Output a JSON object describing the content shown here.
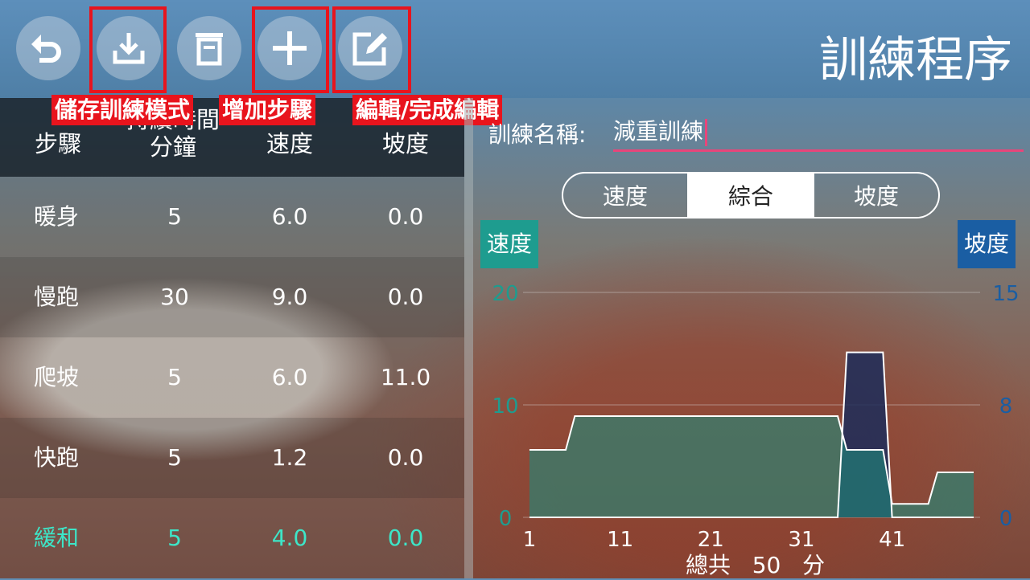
{
  "header": {
    "title": "訓練程序",
    "buttons": [
      {
        "name": "back-button",
        "icon": "back-arrow-icon"
      },
      {
        "name": "save-mode-button",
        "icon": "download-icon"
      },
      {
        "name": "delete-button",
        "icon": "trash-icon"
      },
      {
        "name": "add-step-button",
        "icon": "plus-icon"
      },
      {
        "name": "edit-button",
        "icon": "edit-icon"
      }
    ],
    "callouts": {
      "save": "儲存訓練模式",
      "add": "增加步驟",
      "edit": "編輯/完成編輯"
    }
  },
  "table": {
    "headers": {
      "step": "步驟",
      "duration_line1": "持續時間",
      "duration_line2": "分鐘",
      "speed": "速度",
      "incline": "坡度"
    },
    "rows": [
      {
        "step": "暖身",
        "duration": "5",
        "speed": "6.0",
        "incline": "0.0"
      },
      {
        "step": "慢跑",
        "duration": "30",
        "speed": "9.0",
        "incline": "0.0"
      },
      {
        "step": "爬坡",
        "duration": "5",
        "speed": "6.0",
        "incline": "11.0"
      },
      {
        "step": "快跑",
        "duration": "5",
        "speed": "1.2",
        "incline": "0.0"
      },
      {
        "step": "緩和",
        "duration": "5",
        "speed": "4.0",
        "incline": "0.0"
      }
    ],
    "highlight_color": "#3de6c8"
  },
  "form": {
    "name_label": "訓練名稱:",
    "name_value": "減重訓練",
    "accent": "#e8457a"
  },
  "segmented": {
    "options": [
      "速度",
      "綜合",
      "坡度"
    ],
    "selected": "綜合"
  },
  "chart_data": {
    "type": "area",
    "left_axis_label": "速度",
    "right_axis_label": "坡度",
    "left_color": "#1e9c8f",
    "right_color": "#1a5ea3",
    "left_ylim": [
      0,
      20
    ],
    "right_ylim": [
      0,
      15
    ],
    "left_ticks": [
      "0",
      "10",
      "20"
    ],
    "right_ticks": [
      "0",
      "8",
      "15"
    ],
    "x_ticks": [
      "1",
      "11",
      "21",
      "31",
      "41"
    ],
    "xlim": [
      1,
      50
    ],
    "grid": true,
    "series": [
      {
        "name": "速度",
        "axis": "left",
        "points": [
          [
            1,
            6.0
          ],
          [
            5,
            6.0
          ],
          [
            6,
            9.0
          ],
          [
            35,
            9.0
          ],
          [
            36,
            6.0
          ],
          [
            40,
            6.0
          ],
          [
            41,
            1.2
          ],
          [
            45,
            1.2
          ],
          [
            46,
            4.0
          ],
          [
            50,
            4.0
          ]
        ]
      },
      {
        "name": "坡度",
        "axis": "right",
        "points": [
          [
            1,
            0.0
          ],
          [
            35,
            0.0
          ],
          [
            36,
            11.0
          ],
          [
            40,
            11.0
          ],
          [
            41,
            0.0
          ],
          [
            50,
            0.0
          ]
        ]
      }
    ]
  },
  "footer": {
    "total_label": "總共",
    "total_value": "50",
    "total_unit": "分"
  }
}
